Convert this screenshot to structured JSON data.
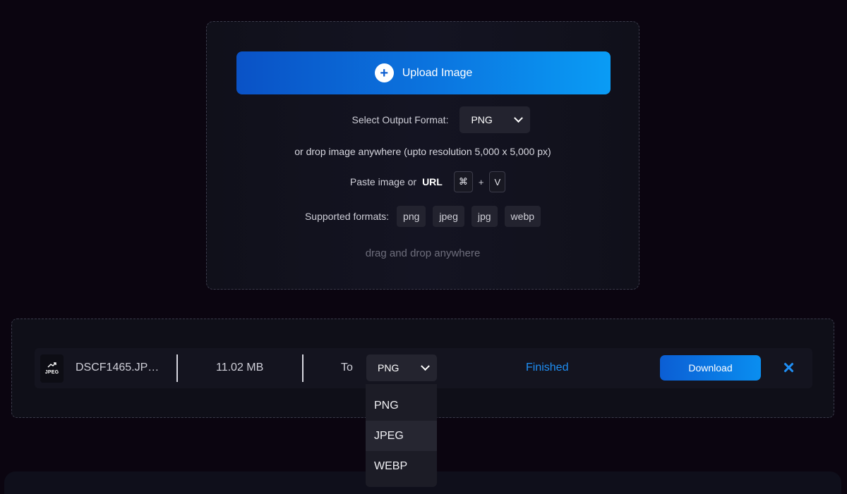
{
  "upload": {
    "button_label": "Upload Image",
    "select_format_label": "Select Output Format:",
    "selected_format": "PNG",
    "drop_hint": "or drop image anywhere (upto resolution 5,000 x 5,000 px)",
    "paste_prefix": "Paste image or",
    "paste_url": "URL",
    "shortcut_key1": "⌘",
    "shortcut_plus": "+",
    "shortcut_key2": "V",
    "supported_label": "Supported formats:",
    "formats": [
      "png",
      "jpeg",
      "jpg",
      "webp"
    ],
    "drag_hint": "drag and drop anywhere"
  },
  "file": {
    "icon_ext": "JPEG",
    "name": "DSCF1465.JP…",
    "size": "11.02 MB",
    "to_label": "To",
    "target_format": "PNG",
    "status": "Finished",
    "download_label": "Download"
  },
  "dropdown": {
    "options": [
      "PNG",
      "JPEG",
      "WEBP"
    ],
    "highlighted": "JPEG"
  },
  "colors": {
    "background": "#0b0510",
    "accent": "#0a8ef0",
    "status": "#1f8ff5"
  }
}
